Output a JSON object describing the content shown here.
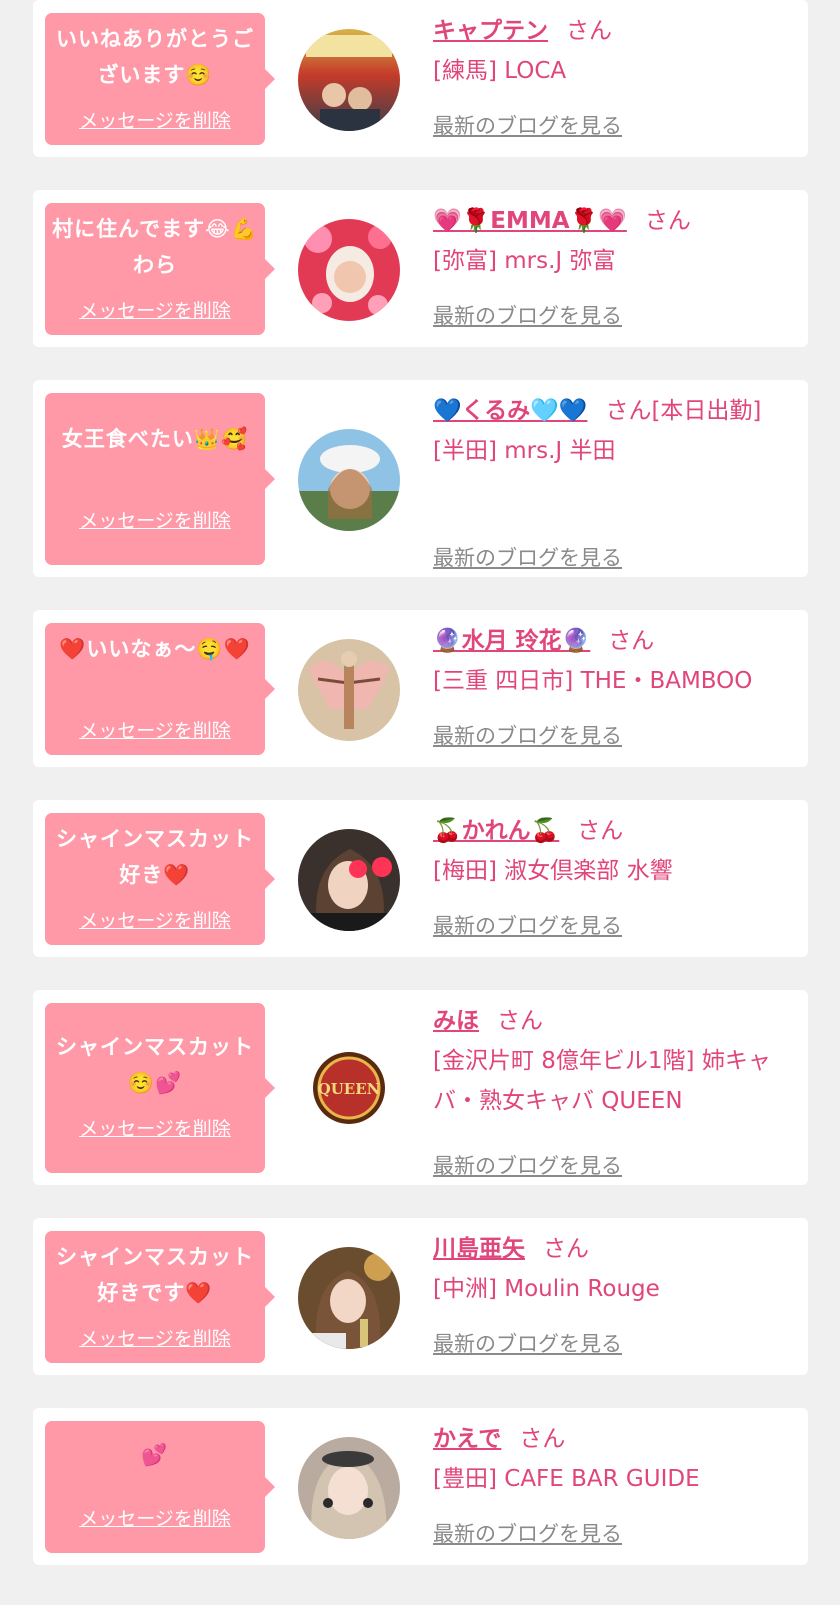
{
  "cards": [
    {
      "message": "いいねありがとうございます☺️",
      "delete_label": "メッセージを削除",
      "name": "キャプテン",
      "honorific": "さん",
      "shop": "[練馬] LOCA",
      "blog_label": "最新のブログを見る",
      "avatar_icon": "profile-photo-icon"
    },
    {
      "message": "村に住んでます😂💪わら",
      "delete_label": "メッセージを削除",
      "name": "💗🌹EMMA🌹💗",
      "honorific": "さん",
      "shop": "[弥富] mrs.J 弥富",
      "blog_label": "最新のブログを見る",
      "avatar_icon": "profile-photo-icon"
    },
    {
      "message": "女王食べたい👑🥰",
      "delete_label": "メッセージを削除",
      "name": "💙くるみ🩵💙",
      "honorific": "さん[本日出勤]",
      "shop": "[半田] mrs.J 半田",
      "blog_label": "最新のブログを見る",
      "avatar_icon": "profile-photo-icon"
    },
    {
      "message": "❤️いいなぁ〜🤤❤️",
      "delete_label": "メッセージを削除",
      "name": "🔮水月 玲花🔮",
      "honorific": "さん",
      "shop": "[三重 四日市] THE・BAMBOO",
      "blog_label": "最新のブログを見る",
      "avatar_icon": "profile-photo-icon"
    },
    {
      "message": "シャインマスカット好き❤️",
      "delete_label": "メッセージを削除",
      "name": "🍒かれん🍒",
      "honorific": "さん",
      "shop": "[梅田] 淑女倶楽部 水響",
      "blog_label": "最新のブログを見る",
      "avatar_icon": "profile-photo-icon"
    },
    {
      "message": "シャインマスカット☺️💕",
      "delete_label": "メッセージを削除",
      "name": "みほ",
      "honorific": "さん",
      "shop": "[金沢片町 8億年ビル1階] 姉キャバ・熟女キャバ QUEEN",
      "blog_label": "最新のブログを見る",
      "avatar_icon": "queen-logo-icon",
      "avatar_text": "QUEEN"
    },
    {
      "message": "シャインマスカット好きです❤️",
      "delete_label": "メッセージを削除",
      "name": "川島亜矢",
      "honorific": "さん",
      "shop": "[中洲] Moulin Rouge",
      "blog_label": "最新のブログを見る",
      "avatar_icon": "profile-photo-icon"
    },
    {
      "message": "💕",
      "delete_label": "メッセージを削除",
      "name": "かえで",
      "honorific": "さん",
      "shop": "[豊田] CAFE BAR GUIDE",
      "blog_label": "最新のブログを見る",
      "avatar_icon": "profile-photo-icon"
    }
  ],
  "colors": {
    "page_background": "#f0f0f0",
    "card_background": "#ffffff",
    "bubble_background": "#ff99a8",
    "accent_pink": "#e0457b",
    "link_gray": "#8a8a8a"
  }
}
